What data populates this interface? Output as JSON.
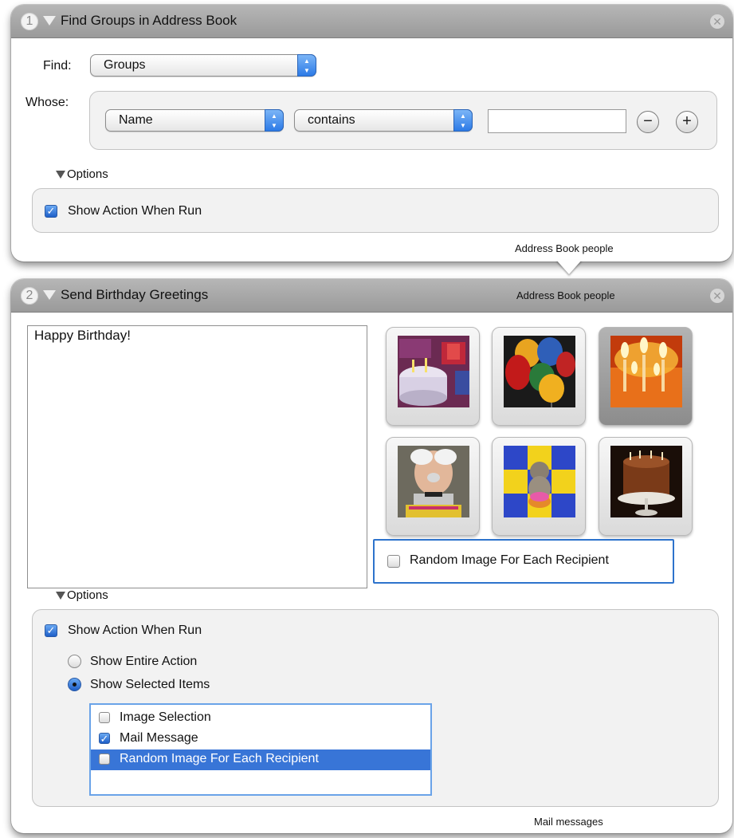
{
  "colors": {
    "header_gray": "#a6a6a6",
    "accent_blue": "#3875d7",
    "focus_blue": "#2d73cc"
  },
  "action1": {
    "step": "1",
    "title": "Find Groups in Address Book",
    "find_label": "Find:",
    "find_value": "Groups",
    "whose_label": "Whose:",
    "field_value": "Name",
    "operator_value": "contains",
    "search_value": "",
    "remove_icon": "−",
    "add_icon": "+",
    "options_label": "Options",
    "show_action_label": "Show Action When Run",
    "show_action_checked": true,
    "output_type": "Address Book people"
  },
  "action2": {
    "step": "2",
    "title": "Send Birthday Greetings",
    "input_type": "Address Book people",
    "message_text": "Happy Birthday!",
    "images": [
      {
        "icon": "cake-with-presents",
        "selected": false
      },
      {
        "icon": "balloons",
        "selected": false
      },
      {
        "icon": "candles",
        "selected": true
      },
      {
        "icon": "old-man-with-cake",
        "selected": false
      },
      {
        "icon": "kitten-with-cupcake",
        "selected": false
      },
      {
        "icon": "chocolate-cake",
        "selected": false
      }
    ],
    "random_image_label": "Random Image For Each Recipient",
    "random_image_checked": false,
    "options_label": "Options",
    "show_action_label": "Show Action When Run",
    "show_action_checked": true,
    "show_entire_label": "Show Entire Action",
    "show_selected_label": "Show Selected Items",
    "show_mode": "selected",
    "items": [
      {
        "label": "Image Selection",
        "checked": false,
        "highlighted": false
      },
      {
        "label": "Mail Message",
        "checked": true,
        "highlighted": false
      },
      {
        "label": "Random Image For Each Recipient",
        "checked": false,
        "highlighted": true
      }
    ],
    "output_type": "Mail messages"
  }
}
